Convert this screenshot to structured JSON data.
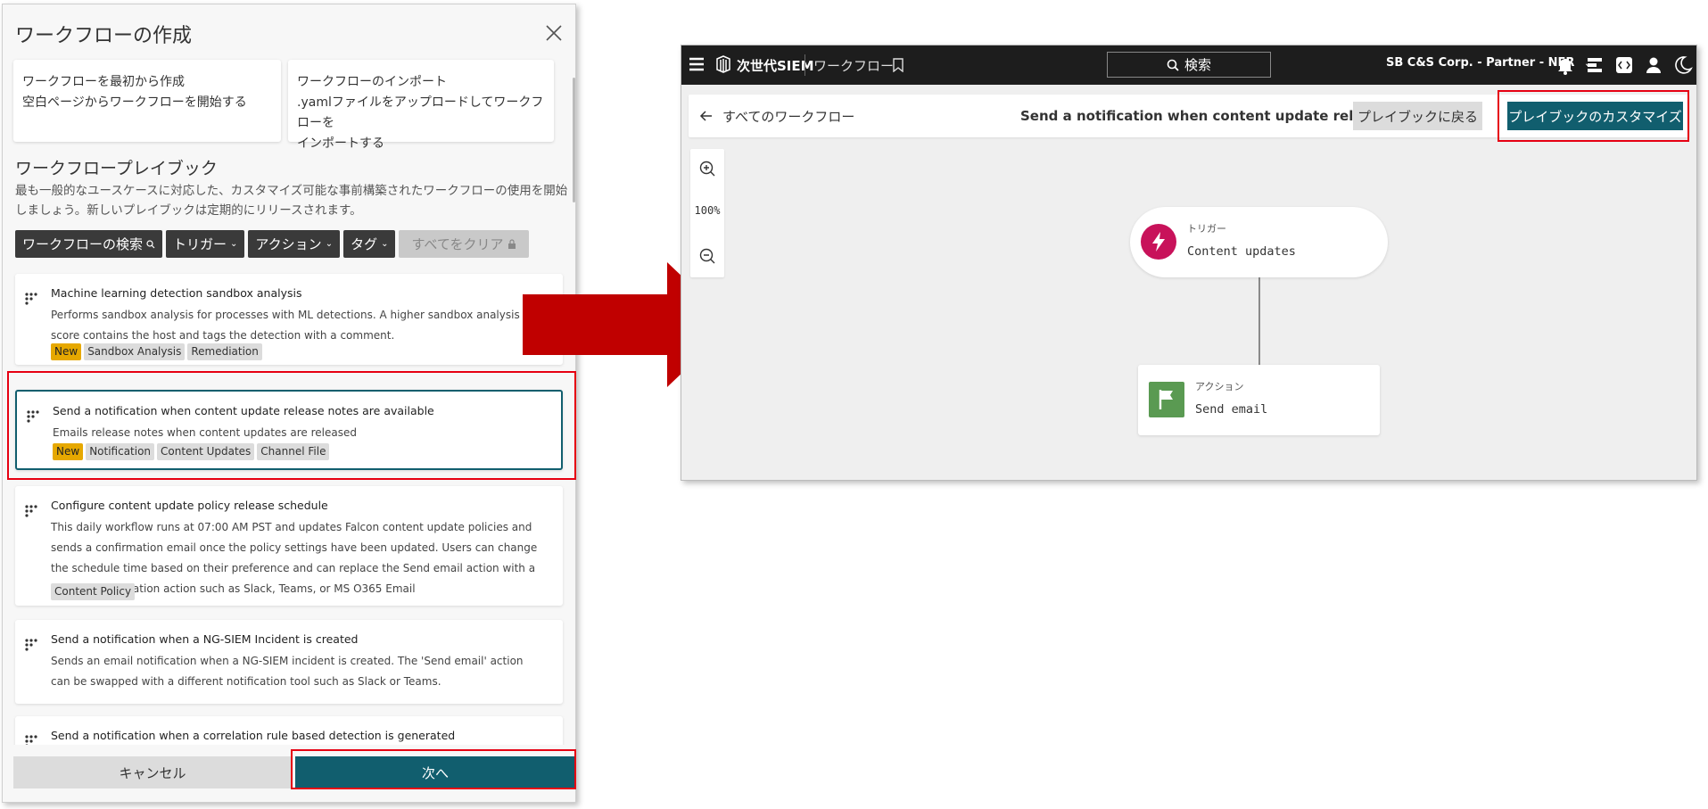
{
  "dialog": {
    "title": "ワークフローの作成",
    "option_scratch": {
      "line1": "ワークフローを最初から作成",
      "line2": "空白ページからワークフローを開始する"
    },
    "option_import": {
      "line1": "ワークフローのインポート",
      "line2": ".yamlファイルをアップロードしてワークフローを",
      "line3": "インポートする"
    },
    "playbook_title": "ワークフロープレイブック",
    "playbook_desc": "最も一般的なユースケースに対応した、カスタマイズ可能な事前構築されたワークフローの使用を開始しましょう。新しいプレイブックは定期的にリリースされます。",
    "filters": {
      "search": "ワークフローの検索",
      "trigger": "トリガー",
      "action": "アクション",
      "tag": "タグ",
      "clear": "すべてをクリア"
    },
    "workflows": [
      {
        "name": "Machine learning detection sandbox analysis",
        "desc": "Performs sandbox analysis for processes with ML detections. A higher sandbox analysis score contains the host and tags the detection with a comment.",
        "tags": [
          "New",
          "Sandbox Analysis",
          "Remediation"
        ]
      },
      {
        "name": "Send a notification when content update release notes are available",
        "desc": "Emails release notes when content updates are released",
        "tags": [
          "New",
          "Notification",
          "Content Updates",
          "Channel File"
        ]
      },
      {
        "name": "Configure content update policy release schedule",
        "desc": "This daily workflow runs at 07:00 AM PST and updates Falcon content update policies and sends a confirmation email once the policy settings have been updated. Users can change the schedule time based on their preference and can replace the Send email action with a different notification action such as Slack, Teams, or MS O365 Email",
        "tags": [
          "Content Policy"
        ]
      },
      {
        "name": "Send a notification when a NG-SIEM Incident is created",
        "desc": "Sends an email notification when a NG-SIEM incident is created. The 'Send email' action can be swapped with a different notification tool such as Slack or Teams.",
        "tags": []
      },
      {
        "name": "Send a notification when a correlation rule based detection is generated",
        "desc": "",
        "tags": []
      }
    ],
    "cancel_label": "キャンセル",
    "next_label": "次へ"
  },
  "app": {
    "brand": "次世代SIEM",
    "section": "ワークフロー",
    "search_label": "検索",
    "org": "SB C&S Corp. - Partner - NFR",
    "back_label": "すべてのワークフロー",
    "workflow_title": "Send a notification when content update release notes ...",
    "back_to_playbook_label": "プレイブックに戻る",
    "customize_label": "プレイブックのカスタマイズ",
    "zoom_level": "100%",
    "trigger_node": {
      "type": "トリガー",
      "name": "Content updates",
      "color": "#c8125a"
    },
    "action_node": {
      "type": "アクション",
      "name": "Send email",
      "color": "#5a9a52"
    }
  },
  "colors": {
    "accent": "#115e6e",
    "highlight": "#e60012",
    "arrow": "#c00000",
    "new_tag": "#e6a800"
  }
}
